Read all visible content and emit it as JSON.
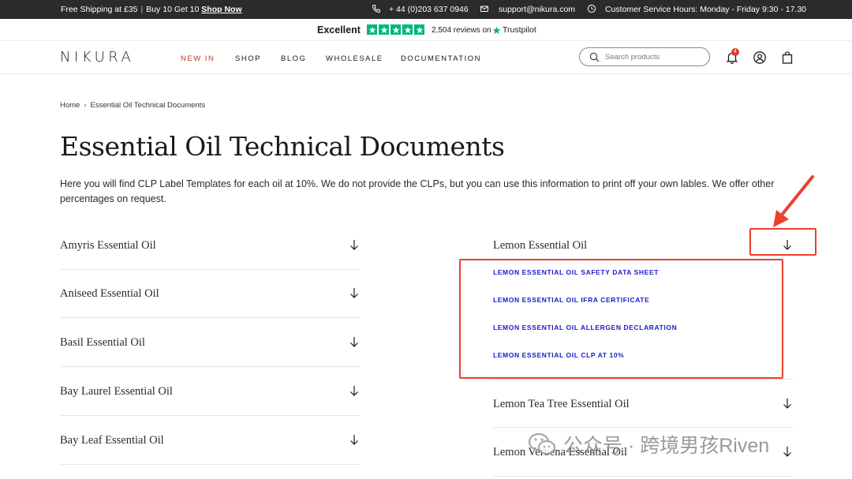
{
  "announcement": {
    "shipping": "Free Shipping at £35",
    "offer": "Buy 10 Get 10",
    "offer_link": "Shop Now",
    "phone": "+ 44 (0)203 637 0946",
    "email": "support@nikura.com",
    "hours": "Customer Service Hours: Monday - Friday 9:30 - 17.30"
  },
  "trustpilot": {
    "rating_text": "Excellent",
    "stars": 5,
    "reviews": "2,504 reviews on",
    "brand": "Trustpilot",
    "color": "#00b67a"
  },
  "header": {
    "logo": "NIKURA",
    "nav": [
      "NEW IN",
      "SHOP",
      "BLOG",
      "WHOLESALE",
      "DOCUMENTATION"
    ],
    "active_nav": "NEW IN",
    "search_placeholder": "Search products",
    "notification_count": "4",
    "accent_color": "#c0392b"
  },
  "breadcrumb": [
    "Home",
    "Essential Oil Technical Documents"
  ],
  "page": {
    "title": "Essential Oil Technical Documents",
    "intro": "Here you will find CLP Label Templates for each oil at 10%. We do not provide the CLPs, but you can use this information to print off your own lables. We offer other percentages on request."
  },
  "left_oils": [
    "Amyris Essential Oil",
    "Aniseed Essential Oil",
    "Basil Essential Oil",
    "Bay Laurel Essential Oil",
    "Bay Leaf Essential Oil"
  ],
  "right_expanded": {
    "title": "Lemon Essential Oil",
    "links": [
      "LEMON ESSENTIAL OIL SAFETY DATA SHEET",
      "LEMON ESSENTIAL OIL IFRA CERTIFICATE",
      "LEMON ESSENTIAL OIL ALLERGEN DECLARATION",
      "LEMON ESSENTIAL OIL CLP AT 10%"
    ],
    "link_color": "#1a1ac8"
  },
  "right_oils": [
    "Lemon Tea Tree Essential Oil",
    "Lemon Verbena Essential Oil"
  ],
  "annotation_color": "#e8412f",
  "watermark": "公众号 · 跨境男孩Riven"
}
